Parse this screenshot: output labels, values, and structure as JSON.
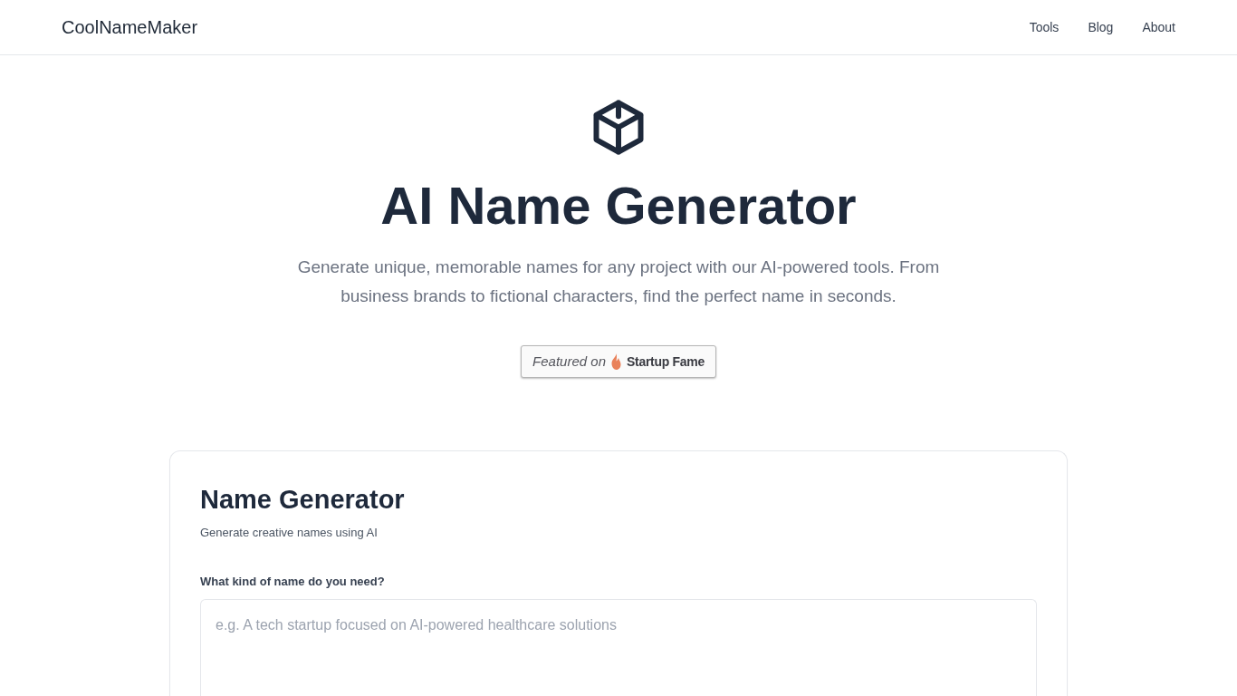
{
  "header": {
    "logo": "CoolNameMaker",
    "nav": [
      "Tools",
      "Blog",
      "About"
    ]
  },
  "hero": {
    "title": "AI Name Generator",
    "subtitle": "Generate unique, memorable names for any project with our AI-powered tools. From business brands to fictional characters, find the perfect name in seconds.",
    "badge": {
      "prefix": "Featured on",
      "brand": "Startup Fame"
    }
  },
  "generator": {
    "title": "Name Generator",
    "subtitle": "Generate creative names using AI",
    "field": {
      "label": "What kind of name do you need?",
      "placeholder": "e.g. A tech startup focused on AI-powered healthcare solutions"
    }
  }
}
